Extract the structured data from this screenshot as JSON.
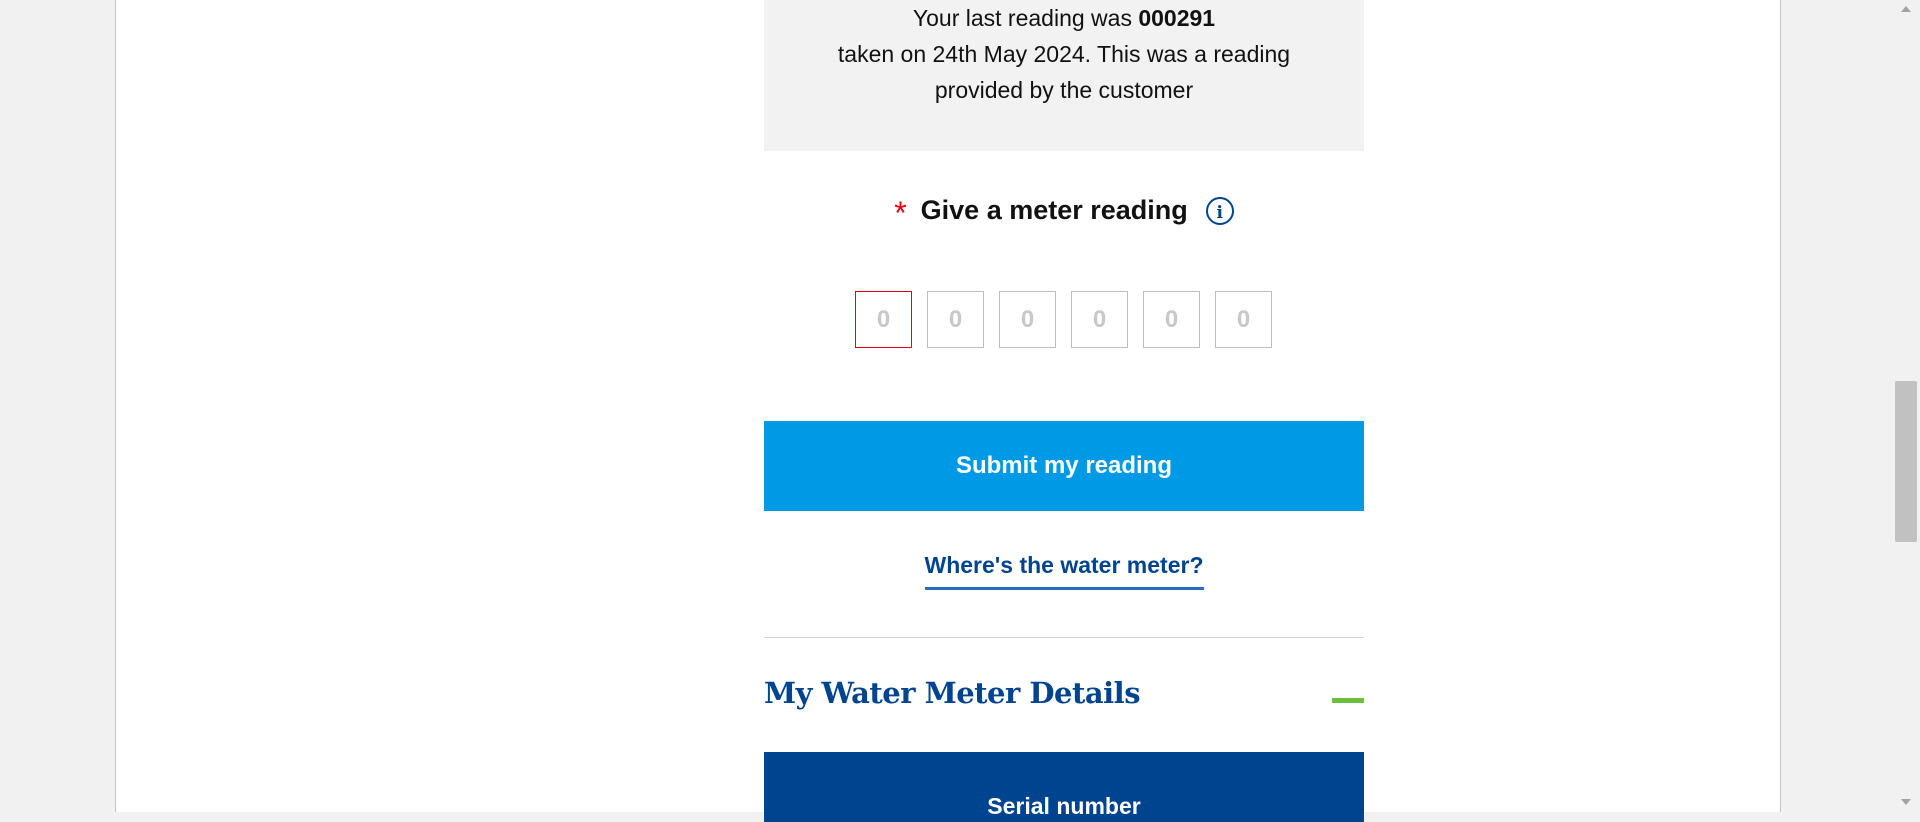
{
  "last_reading": {
    "prefix": "Your last reading was",
    "value": "000291",
    "line2": "taken on 24th May 2024. This was a reading",
    "line3": "provided by the customer"
  },
  "reading_form": {
    "required_marker": "*",
    "label": "Give a meter reading",
    "info_icon": "info-icon",
    "digit_placeholders": [
      "0",
      "0",
      "0",
      "0",
      "0",
      "0"
    ],
    "submit_label": "Submit my reading",
    "help_link": "Where's the water meter?"
  },
  "meter_details": {
    "title": "My Water Meter Details",
    "collapse_icon": "minus-icon",
    "table_header": "Serial number"
  },
  "colors": {
    "primary_blue": "#00438f",
    "button_blue": "#0099e6",
    "required_red": "#e3000f",
    "accent_green": "#6cbf3a"
  }
}
